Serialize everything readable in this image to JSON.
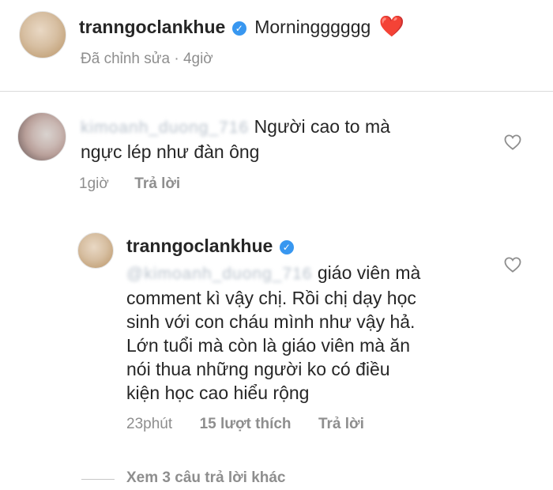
{
  "caption": {
    "username": "tranngoclankhue",
    "text": "Morningggggg",
    "emoji": "❤️",
    "edited_label": "Đã chỉnh sửa",
    "separator": "·",
    "time": "4giờ"
  },
  "comment": {
    "username_blurred": "kimoanh_duong_716",
    "text_line1": "Người cao to mà",
    "text_line2": "ngực lép như đàn ông",
    "time": "1giờ",
    "reply_label": "Trả lời"
  },
  "reply": {
    "username": "tranngoclankhue",
    "mention_blurred": "@kimoanh_duong_716",
    "line1_rest": "giáo viên mà",
    "line2": "comment kì vậy chị. Rồi chị dạy học",
    "line3": "sinh với con cháu mình như vậy hả.",
    "line4": "Lớn tuổi mà còn là giáo viên mà ăn",
    "line5": "nói thua những người ko có điều",
    "line6": "kiện học cao hiểu rộng",
    "time": "23phút",
    "likes": "15 lượt thích",
    "reply_label": "Trả lời"
  },
  "more_replies": {
    "label": "Xem 3 câu trả lời khác"
  },
  "colors": {
    "verified": "#3897f0",
    "heart": "#ed1c24",
    "meta": "#8e8e8e"
  }
}
